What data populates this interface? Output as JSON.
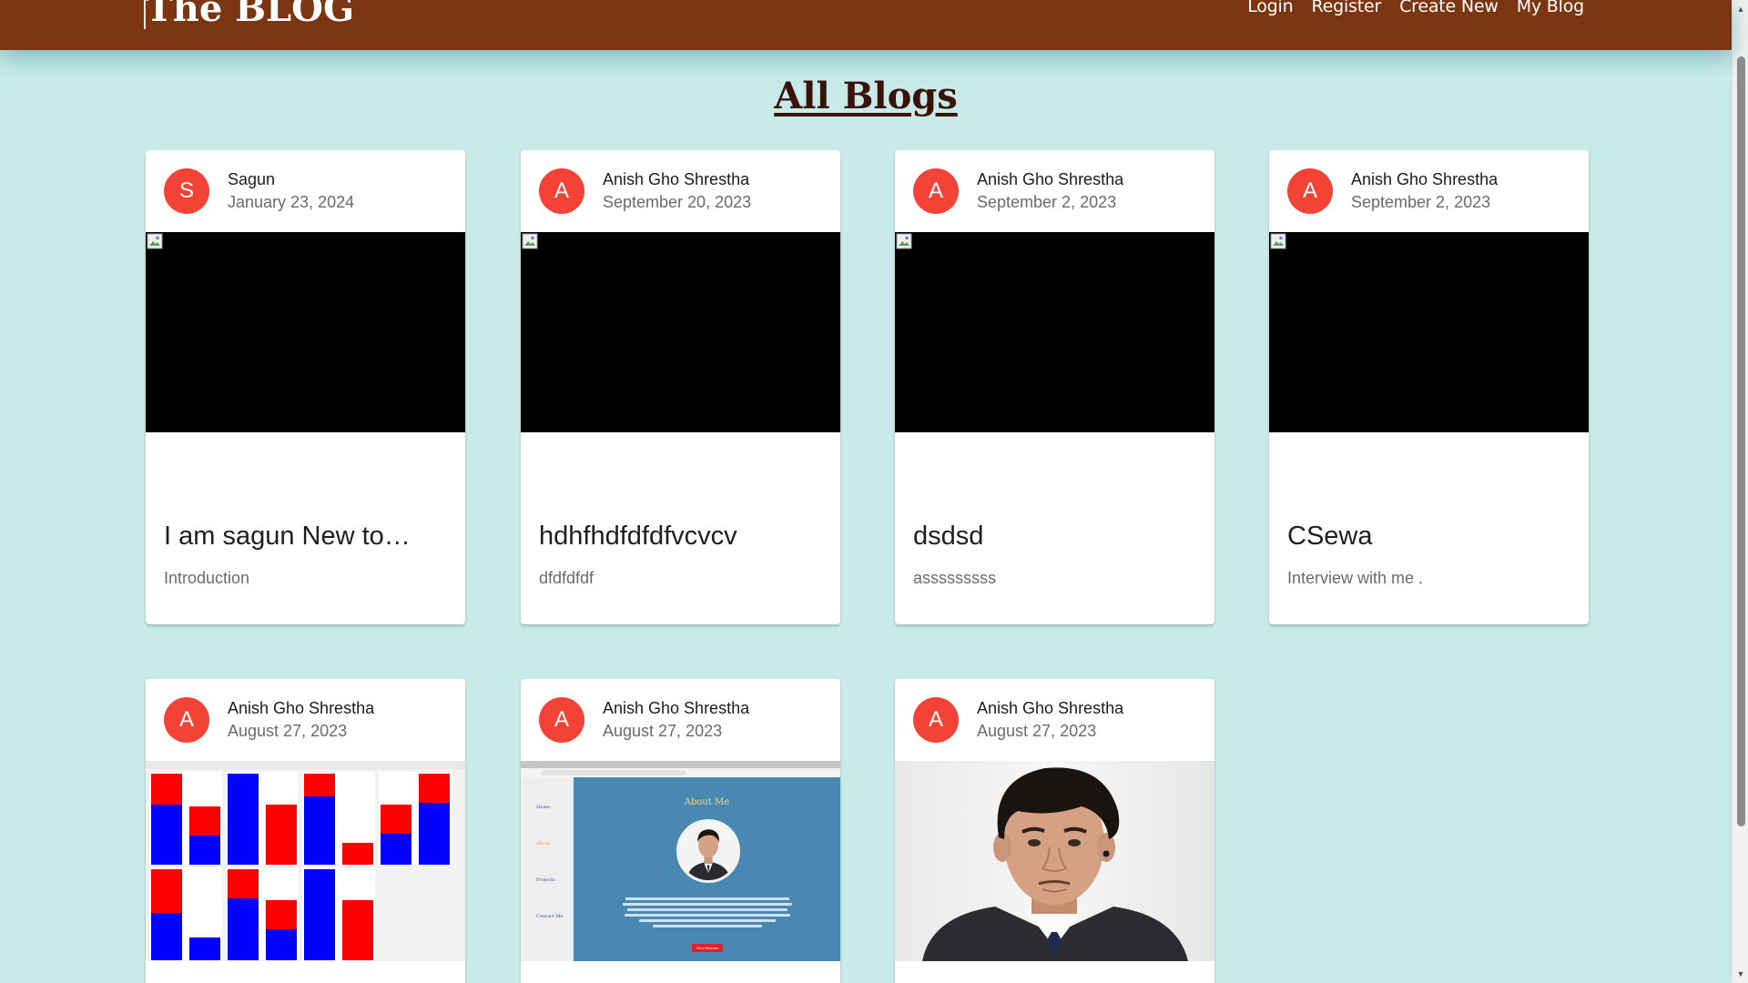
{
  "header": {
    "brand": "The BLOG",
    "nav": [
      "Login",
      "Register",
      "Create New",
      "My Blog"
    ]
  },
  "page_title": "All Blogs",
  "colors": {
    "navbar": "#7b3511",
    "background": "#c8ebea",
    "avatar": "#f44336",
    "title": "#3a1208"
  },
  "icons": {
    "like": "heart-icon",
    "copy": "copy-icon"
  },
  "cards": [
    {
      "initial": "S",
      "author": "Sagun",
      "date": "January 23, 2024",
      "title": "I am sagun New to…",
      "subtitle": "Introduction",
      "media": "broken-image"
    },
    {
      "initial": "A",
      "author": "Anish Gho Shrestha",
      "date": "September 20, 2023",
      "title": "hdhfhdfdfdfvcvcv",
      "subtitle": "dfdfdfdf",
      "media": "broken-image"
    },
    {
      "initial": "A",
      "author": "Anish Gho Shrestha",
      "date": "September 2, 2023",
      "title": "dsdsd",
      "subtitle": "asssssssss",
      "media": "broken-image"
    },
    {
      "initial": "A",
      "author": "Anish Gho Shrestha",
      "date": "September 2, 2023",
      "title": "CSewa",
      "subtitle": "Interview with me .",
      "media": "broken-image"
    },
    {
      "initial": "A",
      "author": "Anish Gho Shrestha",
      "date": "August 27, 2023",
      "media": "chart-screenshot"
    },
    {
      "initial": "A",
      "author": "Anish Gho Shrestha",
      "date": "August 27, 2023",
      "media": "website-screenshot",
      "site": {
        "heading": "About Me",
        "nav": [
          "Home",
          "About",
          "Projects",
          "Contact Me"
        ],
        "button": "View Resume"
      }
    },
    {
      "initial": "A",
      "author": "Anish Gho Shrestha",
      "date": "August 27, 2023",
      "media": "portrait-photo"
    }
  ]
}
